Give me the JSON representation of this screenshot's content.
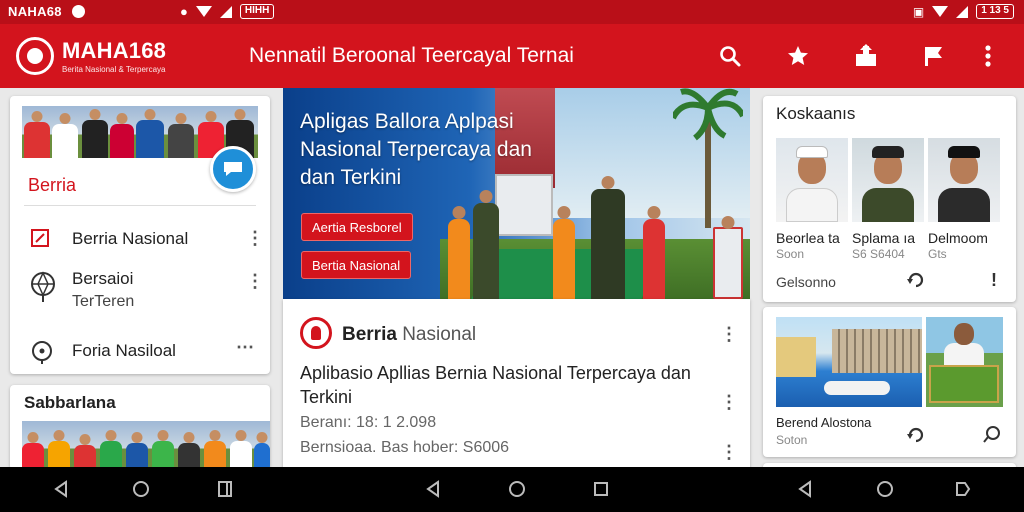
{
  "status_bar": {
    "left_text": "NAHA68",
    "right_badge": "1 13 5",
    "mid_badge": "HIHH"
  },
  "app_bar": {
    "brand": "MAHA168",
    "tagline": "Berita Nasional & Terpercaya",
    "title": "Nennatil Beroonal  Teercayal Ternai",
    "actions": [
      "search-icon",
      "star-icon",
      "share-icon",
      "flag-icon",
      "more-vert-icon"
    ]
  },
  "left_card": {
    "heading": "Berria",
    "items": [
      {
        "label": "Berria Nasional",
        "sublabel": "",
        "icon": "edit-box-icon",
        "menu": "⋮"
      },
      {
        "label": "Bersaioi",
        "sublabel": "TerTeren",
        "icon": "globe-icon",
        "menu": "⋮"
      },
      {
        "label": "Foria Nasiloal",
        "sublabel": "",
        "icon": "location-pin-icon",
        "menu": "⋯"
      }
    ]
  },
  "sab_card": {
    "title": "Sabbarlana"
  },
  "hero": {
    "title": "Apligas Ballora Aplpasi Nasional Terpercaya dan dan Terkini",
    "buttons": [
      "Aertia Resborel",
      "Bertia Nasional"
    ]
  },
  "main_article": {
    "source_bold": "Berria",
    "source_rest": " Nasional",
    "title": "Aplibasio Apllias Bernia Nasional Terpercaya dan Terkini",
    "meta1": "Beranı: 18: 1 2.098",
    "meta2": "Bernsioaa. Bas hober: S6006"
  },
  "right_card_1": {
    "title": "Koskaanıs",
    "people": [
      {
        "name": "Beorlea ta",
        "sub": "Soon"
      },
      {
        "name": "Splama ıa",
        "sub": "S6 S6404"
      },
      {
        "name": "Delmoom",
        "sub": "Gts"
      }
    ],
    "footer": "Gelsonno"
  },
  "right_card_2": {
    "name": "Berend Alostona",
    "sub": "Soton"
  },
  "colors": {
    "app_bar": "#d3141d",
    "status_bar": "#b90f18",
    "accent_blue": "#1f8fd8"
  }
}
